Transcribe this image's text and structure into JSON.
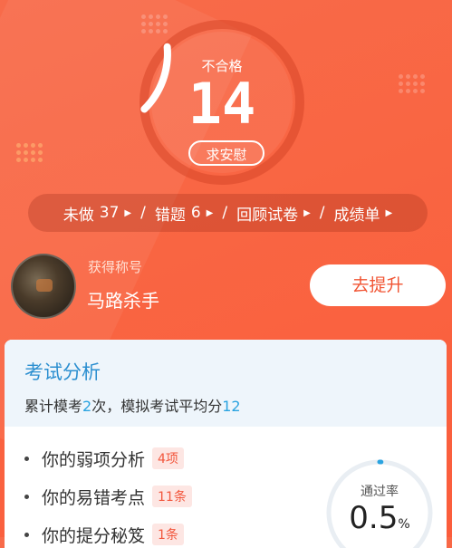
{
  "score": {
    "status_label": "不合格",
    "value": "14",
    "plea_button": "求安慰",
    "ring_fraction": 0.14
  },
  "action_bar": {
    "undone_label": "未做",
    "undone_count": "37",
    "wrong_label": "错题",
    "wrong_count": "6",
    "review_label": "回顾试卷",
    "report_label": "成绩单",
    "separator": "/"
  },
  "profile": {
    "caption": "获得称号",
    "title": "马路杀手",
    "improve_button": "去提升"
  },
  "analysis": {
    "title": "考试分析",
    "summary_prefix": "累计模考",
    "exam_count": "2",
    "summary_middle": "次，模拟考试平均分",
    "average_score": "12",
    "items": [
      {
        "label": "你的弱项分析",
        "badge": "4项"
      },
      {
        "label": "你的易错考点",
        "badge": "11条"
      },
      {
        "label": "你的提分秘笈",
        "badge": "1条"
      }
    ],
    "pass_rate_label": "通过率",
    "pass_rate_value": "0.5",
    "pass_rate_unit": "%"
  },
  "colors": {
    "background": "#f96542",
    "accent_blue": "#2c8fd0",
    "badge_text": "#f2573d",
    "badge_bg": "#fde6e3"
  }
}
